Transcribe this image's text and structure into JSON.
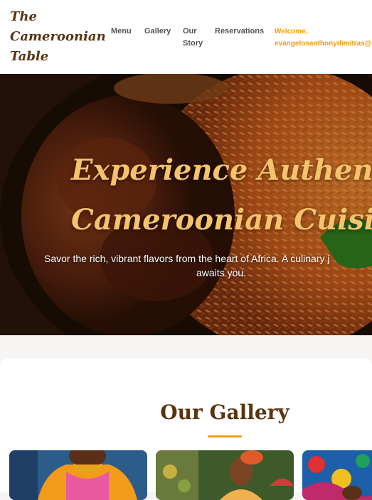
{
  "header": {
    "logo": [
      "The",
      "Cameroonian",
      "Table"
    ],
    "nav": [
      {
        "label": "Menu"
      },
      {
        "label": "Gallery"
      },
      {
        "label": "Our Story"
      },
      {
        "label": "Reservations"
      }
    ],
    "welcome_label": "Welcome,",
    "welcome_user": "evangelosanthonydimitras@gi"
  },
  "hero": {
    "title_line1": "Experience Authentic",
    "title_line2": "Cameroonian Cuisine",
    "subtitle_line1": "Savor the rich, vibrant flavors from the heart of Africa. A culinary j",
    "subtitle_line2": "awaits you."
  },
  "gallery": {
    "title": "Our Gallery"
  },
  "colors": {
    "brand_brown": "#5a3410",
    "accent_orange": "#f39c12",
    "hero_title": "#f5c36b"
  }
}
